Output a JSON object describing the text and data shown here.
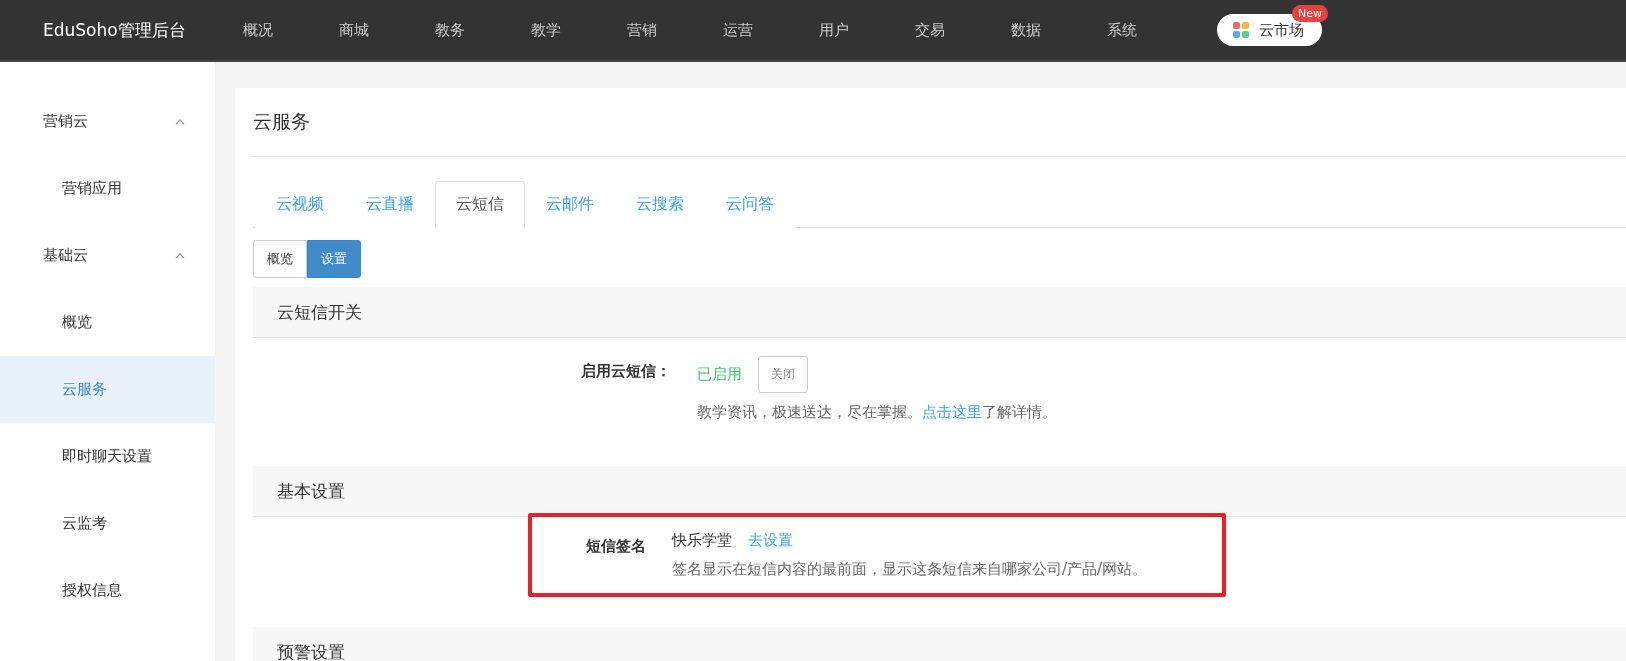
{
  "header": {
    "brand": "EduSoho管理后台",
    "nav": [
      "概况",
      "商城",
      "教务",
      "教学",
      "营销",
      "运营",
      "用户",
      "交易",
      "数据",
      "系统"
    ],
    "market": {
      "label": "云市场",
      "badge": "New"
    }
  },
  "sidebar": {
    "groups": [
      {
        "label": "营销云",
        "expanded": true,
        "children": [
          {
            "label": "营销应用",
            "selected": false
          }
        ]
      },
      {
        "label": "基础云",
        "expanded": true,
        "children": [
          {
            "label": "概览",
            "selected": false
          },
          {
            "label": "云服务",
            "selected": true
          },
          {
            "label": "即时聊天设置",
            "selected": false
          },
          {
            "label": "云监考",
            "selected": false
          },
          {
            "label": "授权信息",
            "selected": false
          }
        ]
      }
    ]
  },
  "page": {
    "title": "云服务",
    "tabs": [
      {
        "label": "云视频",
        "selected": false
      },
      {
        "label": "云直播",
        "selected": false
      },
      {
        "label": "云短信",
        "selected": true
      },
      {
        "label": "云邮件",
        "selected": false
      },
      {
        "label": "云搜索",
        "selected": false
      },
      {
        "label": "云问答",
        "selected": false
      }
    ],
    "subtabs": [
      {
        "label": "概览",
        "selected": false
      },
      {
        "label": "设置",
        "selected": true
      }
    ],
    "sections": [
      {
        "title": "云短信开关",
        "rows": [
          {
            "kind": "switch",
            "label": "启用云短信：",
            "status": "已启用",
            "button": "关闭",
            "help": "教学资讯，极速送达，尽在掌握。",
            "link": "点击这里",
            "help_after": "了解详情。",
            "highlighted": false
          }
        ]
      },
      {
        "title": "基本设置",
        "rows": [
          {
            "kind": "signature",
            "label": "短信签名",
            "value": "快乐学堂",
            "link": "去设置",
            "help": "签名显示在短信内容的最前面，显示这条短信来自哪家公司/产品/网站。",
            "highlighted": true
          }
        ]
      },
      {
        "title": "预警设置"
      }
    ]
  }
}
